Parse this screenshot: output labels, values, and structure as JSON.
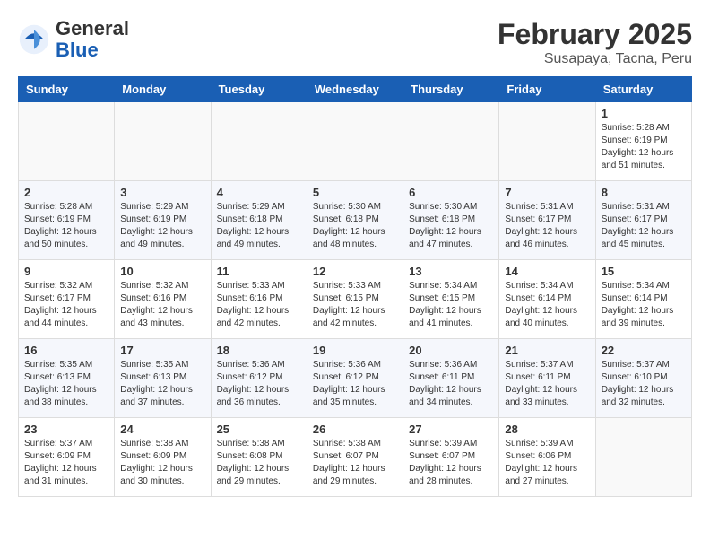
{
  "header": {
    "logo_general": "General",
    "logo_blue": "Blue",
    "title": "February 2025",
    "subtitle": "Susapaya, Tacna, Peru"
  },
  "days_of_week": [
    "Sunday",
    "Monday",
    "Tuesday",
    "Wednesday",
    "Thursday",
    "Friday",
    "Saturday"
  ],
  "weeks": [
    [
      {
        "day": "",
        "info": ""
      },
      {
        "day": "",
        "info": ""
      },
      {
        "day": "",
        "info": ""
      },
      {
        "day": "",
        "info": ""
      },
      {
        "day": "",
        "info": ""
      },
      {
        "day": "",
        "info": ""
      },
      {
        "day": "1",
        "info": "Sunrise: 5:28 AM\nSunset: 6:19 PM\nDaylight: 12 hours\nand 51 minutes."
      }
    ],
    [
      {
        "day": "2",
        "info": "Sunrise: 5:28 AM\nSunset: 6:19 PM\nDaylight: 12 hours\nand 50 minutes."
      },
      {
        "day": "3",
        "info": "Sunrise: 5:29 AM\nSunset: 6:19 PM\nDaylight: 12 hours\nand 49 minutes."
      },
      {
        "day": "4",
        "info": "Sunrise: 5:29 AM\nSunset: 6:18 PM\nDaylight: 12 hours\nand 49 minutes."
      },
      {
        "day": "5",
        "info": "Sunrise: 5:30 AM\nSunset: 6:18 PM\nDaylight: 12 hours\nand 48 minutes."
      },
      {
        "day": "6",
        "info": "Sunrise: 5:30 AM\nSunset: 6:18 PM\nDaylight: 12 hours\nand 47 minutes."
      },
      {
        "day": "7",
        "info": "Sunrise: 5:31 AM\nSunset: 6:17 PM\nDaylight: 12 hours\nand 46 minutes."
      },
      {
        "day": "8",
        "info": "Sunrise: 5:31 AM\nSunset: 6:17 PM\nDaylight: 12 hours\nand 45 minutes."
      }
    ],
    [
      {
        "day": "9",
        "info": "Sunrise: 5:32 AM\nSunset: 6:17 PM\nDaylight: 12 hours\nand 44 minutes."
      },
      {
        "day": "10",
        "info": "Sunrise: 5:32 AM\nSunset: 6:16 PM\nDaylight: 12 hours\nand 43 minutes."
      },
      {
        "day": "11",
        "info": "Sunrise: 5:33 AM\nSunset: 6:16 PM\nDaylight: 12 hours\nand 42 minutes."
      },
      {
        "day": "12",
        "info": "Sunrise: 5:33 AM\nSunset: 6:15 PM\nDaylight: 12 hours\nand 42 minutes."
      },
      {
        "day": "13",
        "info": "Sunrise: 5:34 AM\nSunset: 6:15 PM\nDaylight: 12 hours\nand 41 minutes."
      },
      {
        "day": "14",
        "info": "Sunrise: 5:34 AM\nSunset: 6:14 PM\nDaylight: 12 hours\nand 40 minutes."
      },
      {
        "day": "15",
        "info": "Sunrise: 5:34 AM\nSunset: 6:14 PM\nDaylight: 12 hours\nand 39 minutes."
      }
    ],
    [
      {
        "day": "16",
        "info": "Sunrise: 5:35 AM\nSunset: 6:13 PM\nDaylight: 12 hours\nand 38 minutes."
      },
      {
        "day": "17",
        "info": "Sunrise: 5:35 AM\nSunset: 6:13 PM\nDaylight: 12 hours\nand 37 minutes."
      },
      {
        "day": "18",
        "info": "Sunrise: 5:36 AM\nSunset: 6:12 PM\nDaylight: 12 hours\nand 36 minutes."
      },
      {
        "day": "19",
        "info": "Sunrise: 5:36 AM\nSunset: 6:12 PM\nDaylight: 12 hours\nand 35 minutes."
      },
      {
        "day": "20",
        "info": "Sunrise: 5:36 AM\nSunset: 6:11 PM\nDaylight: 12 hours\nand 34 minutes."
      },
      {
        "day": "21",
        "info": "Sunrise: 5:37 AM\nSunset: 6:11 PM\nDaylight: 12 hours\nand 33 minutes."
      },
      {
        "day": "22",
        "info": "Sunrise: 5:37 AM\nSunset: 6:10 PM\nDaylight: 12 hours\nand 32 minutes."
      }
    ],
    [
      {
        "day": "23",
        "info": "Sunrise: 5:37 AM\nSunset: 6:09 PM\nDaylight: 12 hours\nand 31 minutes."
      },
      {
        "day": "24",
        "info": "Sunrise: 5:38 AM\nSunset: 6:09 PM\nDaylight: 12 hours\nand 30 minutes."
      },
      {
        "day": "25",
        "info": "Sunrise: 5:38 AM\nSunset: 6:08 PM\nDaylight: 12 hours\nand 29 minutes."
      },
      {
        "day": "26",
        "info": "Sunrise: 5:38 AM\nSunset: 6:07 PM\nDaylight: 12 hours\nand 29 minutes."
      },
      {
        "day": "27",
        "info": "Sunrise: 5:39 AM\nSunset: 6:07 PM\nDaylight: 12 hours\nand 28 minutes."
      },
      {
        "day": "28",
        "info": "Sunrise: 5:39 AM\nSunset: 6:06 PM\nDaylight: 12 hours\nand 27 minutes."
      },
      {
        "day": "",
        "info": ""
      }
    ]
  ]
}
